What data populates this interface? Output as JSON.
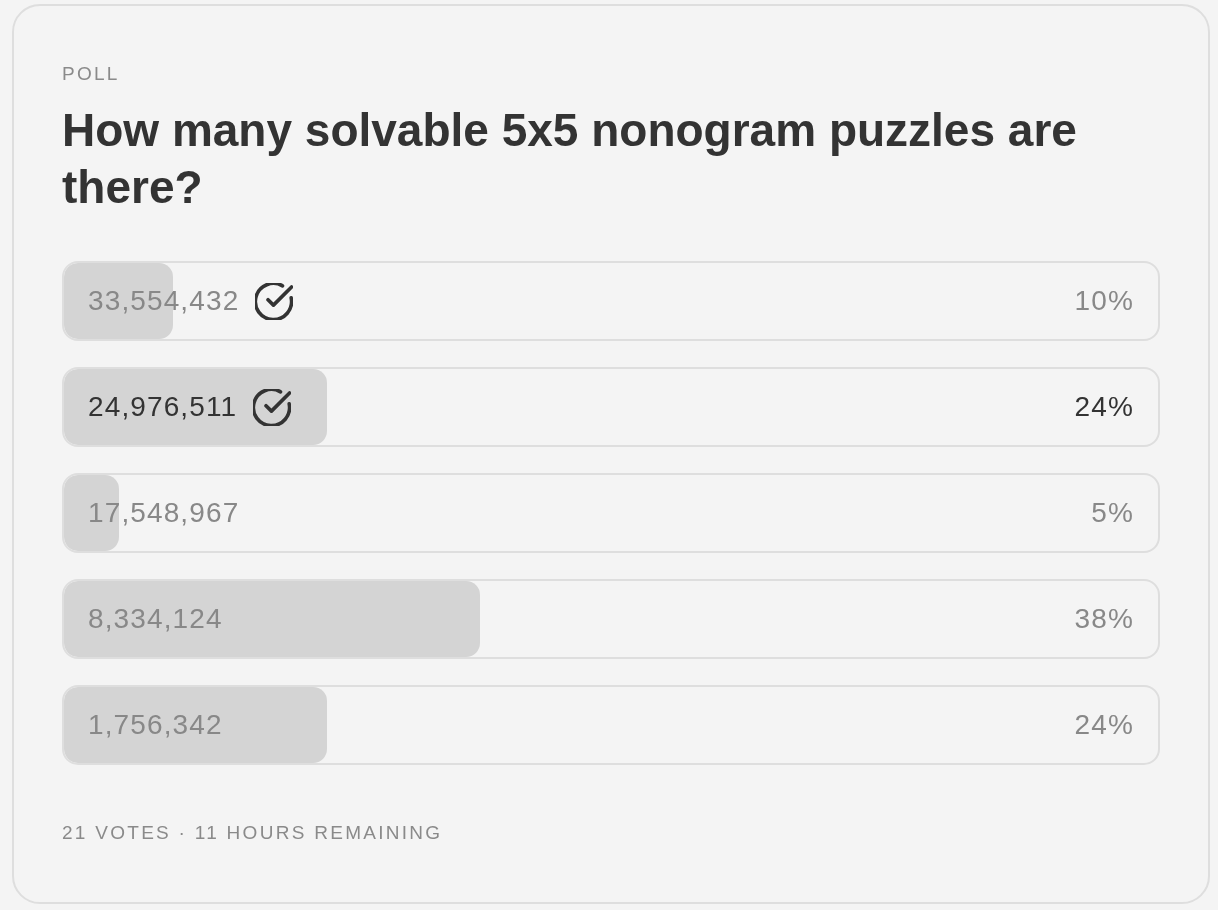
{
  "poll": {
    "label": "POLL",
    "question": "How many solvable 5x5 nonogram puzzles are there?"
  },
  "options": [
    {
      "label": "33,554,432",
      "checked": true,
      "selected": false,
      "level": 0.1,
      "percent": "10%"
    },
    {
      "label": "24,976,511",
      "checked": true,
      "selected": true,
      "level": 0.24,
      "percent": "24%"
    },
    {
      "label": "17,548,967",
      "checked": false,
      "selected": false,
      "level": 0.05,
      "percent": "5%"
    },
    {
      "label": "8,334,124",
      "checked": false,
      "selected": false,
      "level": 0.38,
      "percent": "38%"
    },
    {
      "label": "1,756,342",
      "checked": false,
      "selected": false,
      "level": 0.24,
      "percent": "24%"
    }
  ],
  "footer": "21 VOTES · 11 HOURS REMAINING"
}
